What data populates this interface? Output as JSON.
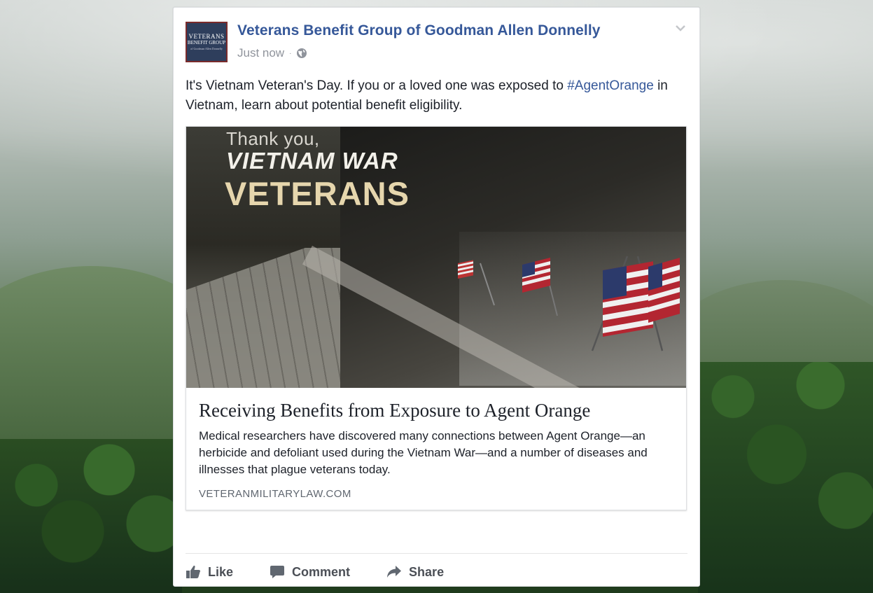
{
  "post": {
    "avatar_lines": [
      "VETERANS",
      "BENEFIT GROUP",
      "of Goodman Allen Donnelly"
    ],
    "page_name": "Veterans Benefit Group of Goodman Allen Donnelly",
    "timestamp": "Just now",
    "separator": "·",
    "privacy_icon": "globe-icon",
    "menu_icon": "chevron-down-icon",
    "text_before": "It's Vietnam Veteran's Day. If you or a loved one was exposed to ",
    "hashtag": "#AgentOrange",
    "text_after": " in Vietnam, learn about potential benefit eligibility."
  },
  "link_preview": {
    "image_text": {
      "line1": "Thank you,",
      "line2": "VIETNAM WAR",
      "line3": "VETERANS"
    },
    "title": "Receiving Benefits from Exposure to Agent Orange",
    "description": "Medical researchers have discovered many connections between Agent Orange—an herbicide and defoliant used during the Vietnam War—and a number of diseases and illnesses that plague veterans today.",
    "domain": "VETERANMILITARYLAW.COM"
  },
  "actions": [
    {
      "label": "Like",
      "icon": "thumbs-up-icon"
    },
    {
      "label": "Comment",
      "icon": "comment-icon"
    },
    {
      "label": "Share",
      "icon": "share-icon"
    }
  ],
  "colors": {
    "link_blue": "#365899",
    "text": "#1d2129",
    "meta_gray": "#90949c"
  }
}
